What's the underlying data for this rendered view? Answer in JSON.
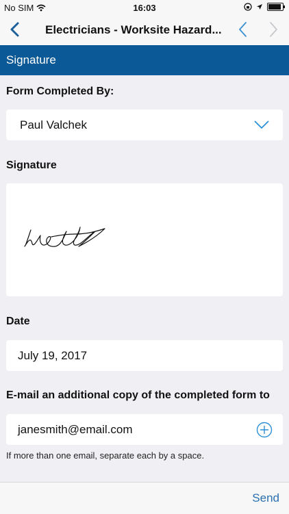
{
  "status": {
    "carrier": "No SIM",
    "time": "16:03"
  },
  "nav": {
    "title": "Electricians - Worksite Hazard..."
  },
  "section": {
    "title": "Signature"
  },
  "form": {
    "completed_by_label": "Form Completed By:",
    "completed_by_value": "Paul Valchek",
    "signature_label": "Signature",
    "date_label": "Date",
    "date_value": "July 19, 2017",
    "email_label": "E-mail an additional copy of the completed form to",
    "email_value": "janesmith@email.com",
    "email_helper": "If more than one email, separate each by a space."
  },
  "footer": {
    "send_label": "Send"
  },
  "colors": {
    "header": "#0b5996",
    "accent": "#2a8fd6",
    "send": "#2a6fb0"
  }
}
